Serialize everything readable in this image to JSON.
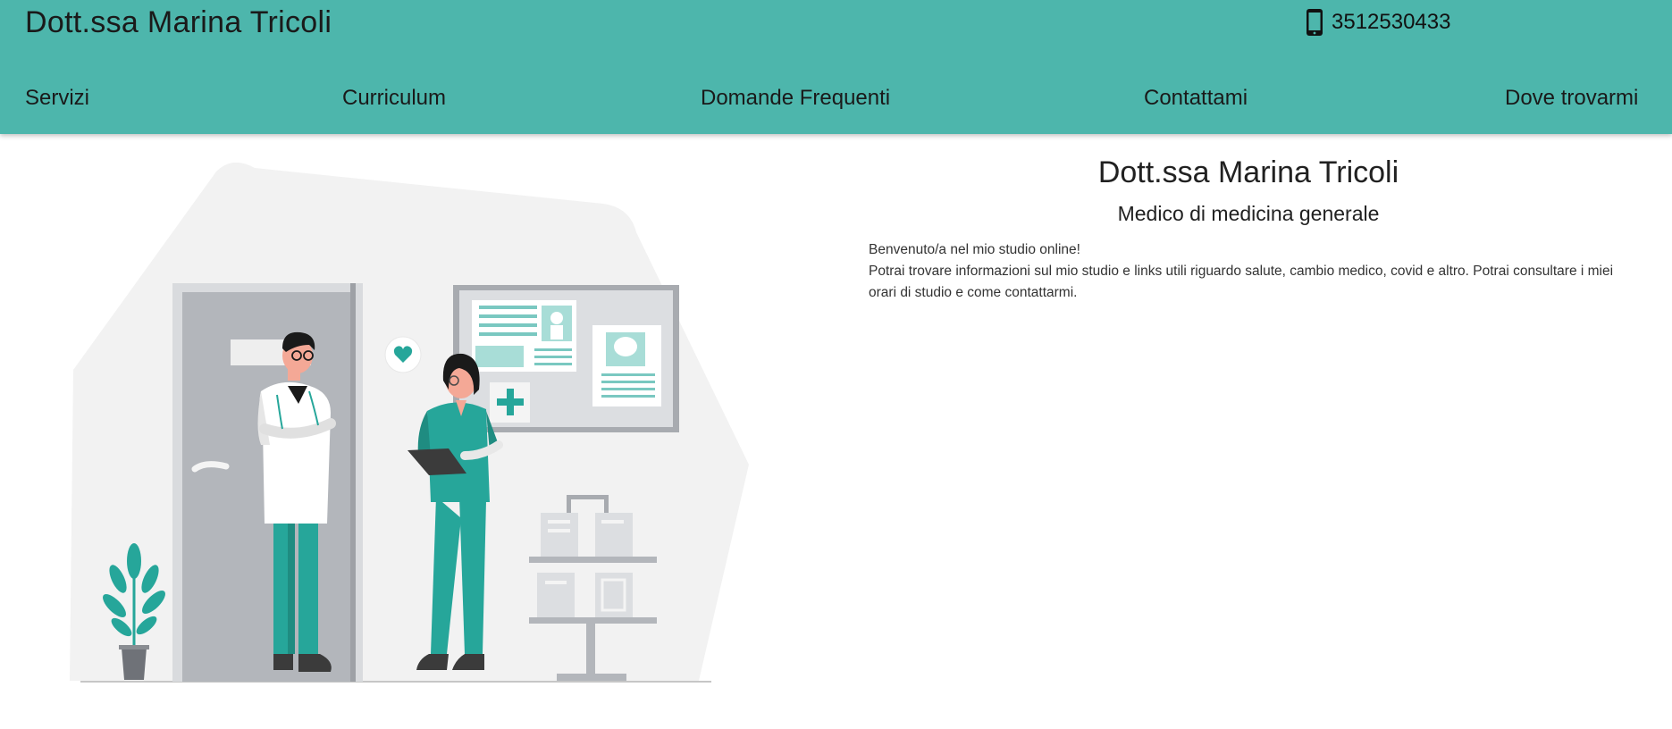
{
  "header": {
    "title": "Dott.ssa Marina Tricoli",
    "phone": "3512530433",
    "phone_icon": "mobile-phone-icon",
    "background": "#4db6ac"
  },
  "nav": {
    "items": [
      {
        "label": "Servizi"
      },
      {
        "label": "Curriculum"
      },
      {
        "label": "Domande Frequenti"
      },
      {
        "label": "Contattami"
      },
      {
        "label": "Dove trovarmi"
      }
    ]
  },
  "hero": {
    "illustration": "doctor-and-nurse-illustration",
    "accent": "#26a69a"
  },
  "main": {
    "title": "Dott.ssa Marina Tricoli",
    "subtitle": "Medico di medicina generale",
    "paragraphs": [
      "Benvenuto/a nel mio studio online!",
      "Potrai trovare informazioni sul mio studio e links utili riguardo salute, cambio medico, covid e altro. Potrai consultare i miei orari di studio e come contattarmi."
    ]
  }
}
